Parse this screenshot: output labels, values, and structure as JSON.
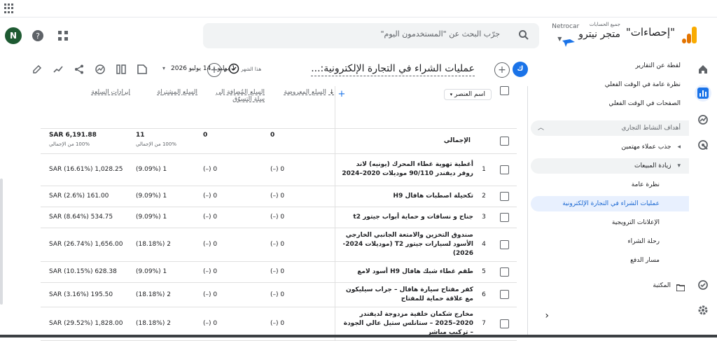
{
  "header": {
    "avatar_letter": "N",
    "search_placeholder": "جرّب البحث عن \"المستخدمون اليوم\"",
    "all_accounts": "جميع الحسابات",
    "account_name": "Netrocar",
    "property_name": "متجر نيترو",
    "product_title": "\"إحصاءات\"",
    "brand_colors": {
      "orange": "#f9ab00",
      "dark_orange": "#e37400"
    }
  },
  "rail": {
    "icons": [
      "home-icon",
      "reports-icon",
      "explore-icon",
      "advertising-icon",
      "configure-icon",
      "settings-icon"
    ],
    "collapse_icon": "chevron-left-icon"
  },
  "nav": {
    "items": [
      {
        "label": "لقطة عن التقارير"
      },
      {
        "label": "نظرة عامة في الوقت الفعلي"
      },
      {
        "label": "الصفحات في الوقت الفعلي"
      },
      {
        "label": "أهداف النشاط التجاري"
      },
      {
        "label": "جذب عملاء مهتمين"
      },
      {
        "label": "زيادة المبيعات"
      },
      {
        "label": "نظرة عامة"
      },
      {
        "label": "عمليات الشراء في التجارة الإلكترونية"
      },
      {
        "label": "الإعلانات الترويجية"
      },
      {
        "label": "رحلة الشراء"
      },
      {
        "label": "مسار الدفع"
      }
    ],
    "library_label": "المكتبة"
  },
  "toolbar": {
    "report_title": "عمليات الشراء في التجارة الإلكترونية:...",
    "badge_letter": "ك",
    "date_prefix": "هذا الشهر",
    "date_range": "1 يوليو - 14 يوليو 2026"
  },
  "table": {
    "dimension_label": "اسم العنصر",
    "columns": [
      "السلع المعروضة",
      "السلع المُضافة إلى سلة التسوّق",
      "السلع المشتراة",
      "إيرادات السلعة"
    ],
    "total_label": "الإجمالي",
    "totals": {
      "viewed": "0",
      "added": "0",
      "purchased": "11",
      "purchased_pct": "100% من الإجمالي",
      "revenue": "SAR 6,191.88",
      "revenue_pct": "100% من الإجمالي"
    },
    "rows": [
      {
        "n": "1",
        "name": "أغطية تهوية غطاء المحرك (يونيه) لاند روفر ديفندر 90/110 موديلات 2020–2024",
        "viewed": "0 (–)",
        "added": "0 (–)",
        "purchased": "1 (9.09%)",
        "revenue": "SAR (16.61%) 1,028.25"
      },
      {
        "n": "2",
        "name": "تكحيلة اصطبات هافال H9",
        "viewed": "0 (–)",
        "added": "0 (–)",
        "purchased": "1 (9.09%)",
        "revenue": "SAR (2.6%) 161.00"
      },
      {
        "n": "3",
        "name": "جناح و نسافات و حماية أبواب جيتور t2",
        "viewed": "0 (–)",
        "added": "0 (–)",
        "purchased": "1 (9.09%)",
        "revenue": "SAR (8.64%) 534.75"
      },
      {
        "n": "4",
        "name": "صندوق التخزين والامتعة الجانبي الخارجي الأسود لسيارات جيتور T2 (موديلات 2024-2026)",
        "viewed": "0 (–)",
        "added": "0 (–)",
        "purchased": "2 (18.18%)",
        "revenue": "SAR (26.74%) 1,656.00"
      },
      {
        "n": "5",
        "name": "طقم غطاء شبك هافال H9 أسود لامع",
        "viewed": "0 (–)",
        "added": "0 (–)",
        "purchased": "1 (9.09%)",
        "revenue": "SAR (10.15%) 628.38"
      },
      {
        "n": "6",
        "name": "كفر مفتاح سيارة هافال – جراب سيليكون مع علاقة حماية للمفتاح",
        "viewed": "0 (–)",
        "added": "0 (–)",
        "purchased": "2 (18.18%)",
        "revenue": "SAR (3.16%) 195.50"
      },
      {
        "n": "7",
        "name": "مخارج شكمان خلفية مزدوجة لديفندر 2020–2025 – ستانلس ستيل عالي الجودة – تركيب مباشر",
        "viewed": "0 (–)",
        "added": "0 (–)",
        "purchased": "2 (18.18%)",
        "revenue": "SAR (29.52%) 1,828.00"
      }
    ]
  }
}
